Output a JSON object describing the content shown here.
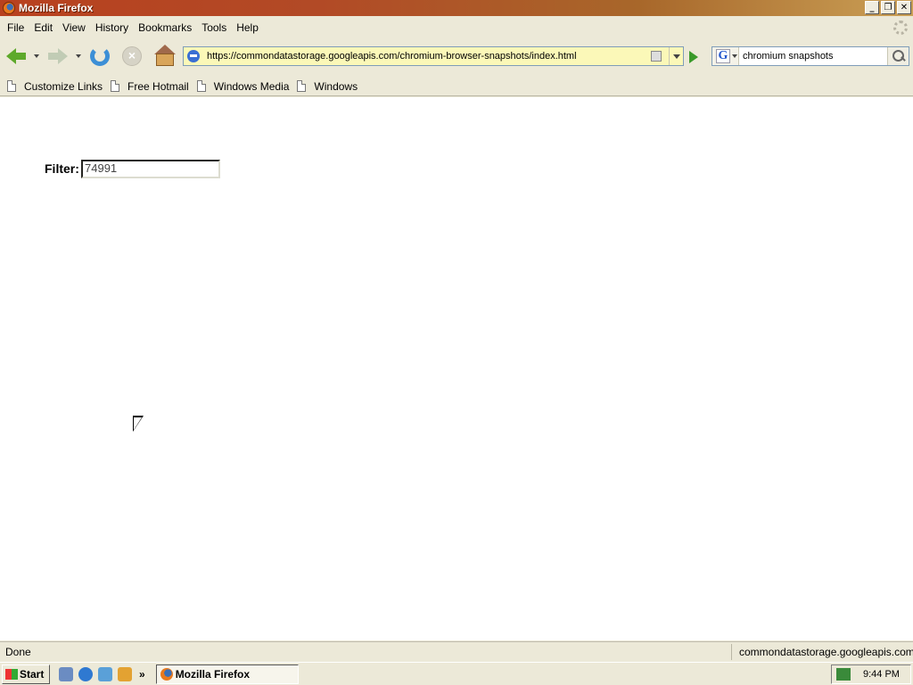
{
  "window": {
    "title": "Mozilla Firefox"
  },
  "menu": [
    "File",
    "Edit",
    "View",
    "History",
    "Bookmarks",
    "Tools",
    "Help"
  ],
  "navigation": {
    "url": "https://commondatastorage.googleapis.com/chromium-browser-snapshots/index.html",
    "search_engine": "G",
    "search_query": "chromium snapshots"
  },
  "bookmarks": [
    "Customize Links",
    "Free Hotmail",
    "Windows Media",
    "Windows"
  ],
  "page": {
    "filter_label": "Filter:",
    "filter_value": "74991"
  },
  "status": {
    "text": "Done",
    "host": "commondatastorage.googleapis.com"
  },
  "taskbar": {
    "start_label": "Start",
    "quick_launch_more": "»",
    "active_task": "Mozilla Firefox",
    "clock": "9:44 PM"
  }
}
